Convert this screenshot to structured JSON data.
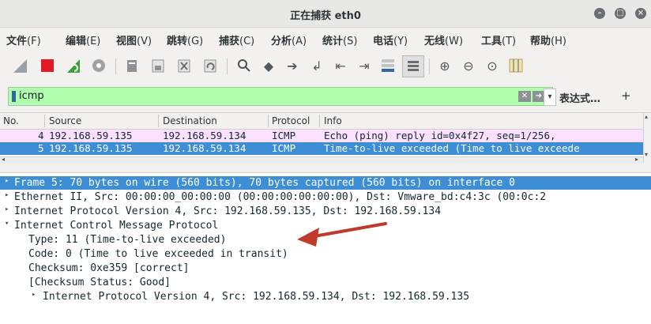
{
  "window": {
    "title": "正在捕获 eth0"
  },
  "menu": [
    {
      "label": "文件",
      "key": "(F)"
    },
    {
      "label": "编辑",
      "key": "(E)"
    },
    {
      "label": "视图",
      "key": "(V)"
    },
    {
      "label": "跳转",
      "key": "(G)"
    },
    {
      "label": "捕获",
      "key": "(C)"
    },
    {
      "label": "分析",
      "key": "(A)"
    },
    {
      "label": "统计",
      "key": "(S)"
    },
    {
      "label": "电话",
      "key": "(Y)"
    },
    {
      "label": "无线",
      "key": "(W)"
    },
    {
      "label": "工具",
      "key": "(T)"
    },
    {
      "label": "帮助",
      "key": "(H)"
    }
  ],
  "toolbar_icons": [
    "shark-fin-start-icon",
    "stop-capture-icon",
    "restart-capture-icon",
    "capture-options-icon",
    "open-file-icon",
    "save-file-icon",
    "close-file-icon",
    "reload-file-icon",
    "find-packet-icon",
    "go-back-icon",
    "go-forward-icon",
    "go-to-packet-icon",
    "first-packet-icon",
    "last-packet-icon",
    "autoscroll-icon",
    "colorize-icon",
    "zoom-in-icon",
    "zoom-out-icon",
    "normal-size-icon",
    "resize-columns-icon"
  ],
  "filter": {
    "value": "icmp",
    "expression_label": "表达式…",
    "plus_label": "+"
  },
  "packet_list": {
    "columns": [
      "No.",
      "Source",
      "Destination",
      "Protocol",
      "Info"
    ],
    "rows": [
      {
        "no": "4",
        "source": "192.168.59.135",
        "destination": "192.168.59.134",
        "protocol": "ICMP",
        "info": "Echo (ping) reply    id=0x4f27, seq=1/256,"
      },
      {
        "no": "5",
        "source": "192.168.59.135",
        "destination": "192.168.59.134",
        "protocol": "ICMP",
        "info": "Time-to-live exceeded (Time to live exceede"
      }
    ]
  },
  "details": [
    {
      "arrow": "▸",
      "text": "Frame 5: 70 bytes on wire (560 bits), 70 bytes captured (560 bits) on interface 0"
    },
    {
      "arrow": "▸",
      "text": "Ethernet II, Src: 00:00:00_00:00:00 (00:00:00:00:00:00), Dst: Vmware_bd:c4:3c (00:0c:2"
    },
    {
      "arrow": "▸",
      "text": "Internet Protocol Version 4, Src: 192.168.59.135, Dst: 192.168.59.134"
    },
    {
      "arrow": "▾",
      "text": "Internet Control Message Protocol"
    },
    {
      "arrow": "",
      "text": "Type: 11 (Time-to-live exceeded)"
    },
    {
      "arrow": "",
      "text": "Code: 0 (Time to live exceeded in transit)"
    },
    {
      "arrow": "",
      "text": "Checksum: 0xe359 [correct]"
    },
    {
      "arrow": "",
      "text": "[Checksum Status: Good]"
    },
    {
      "arrow": "▸",
      "text": "Internet Protocol Version 4, Src: 192.168.59.134, Dst: 192.168.59.135"
    }
  ],
  "colors": {
    "filter_bg": "#afffaf",
    "selected_row": "#3e8ed6",
    "icmp_row": "#fce0ff",
    "annotation_arrow": "#c0392b"
  }
}
